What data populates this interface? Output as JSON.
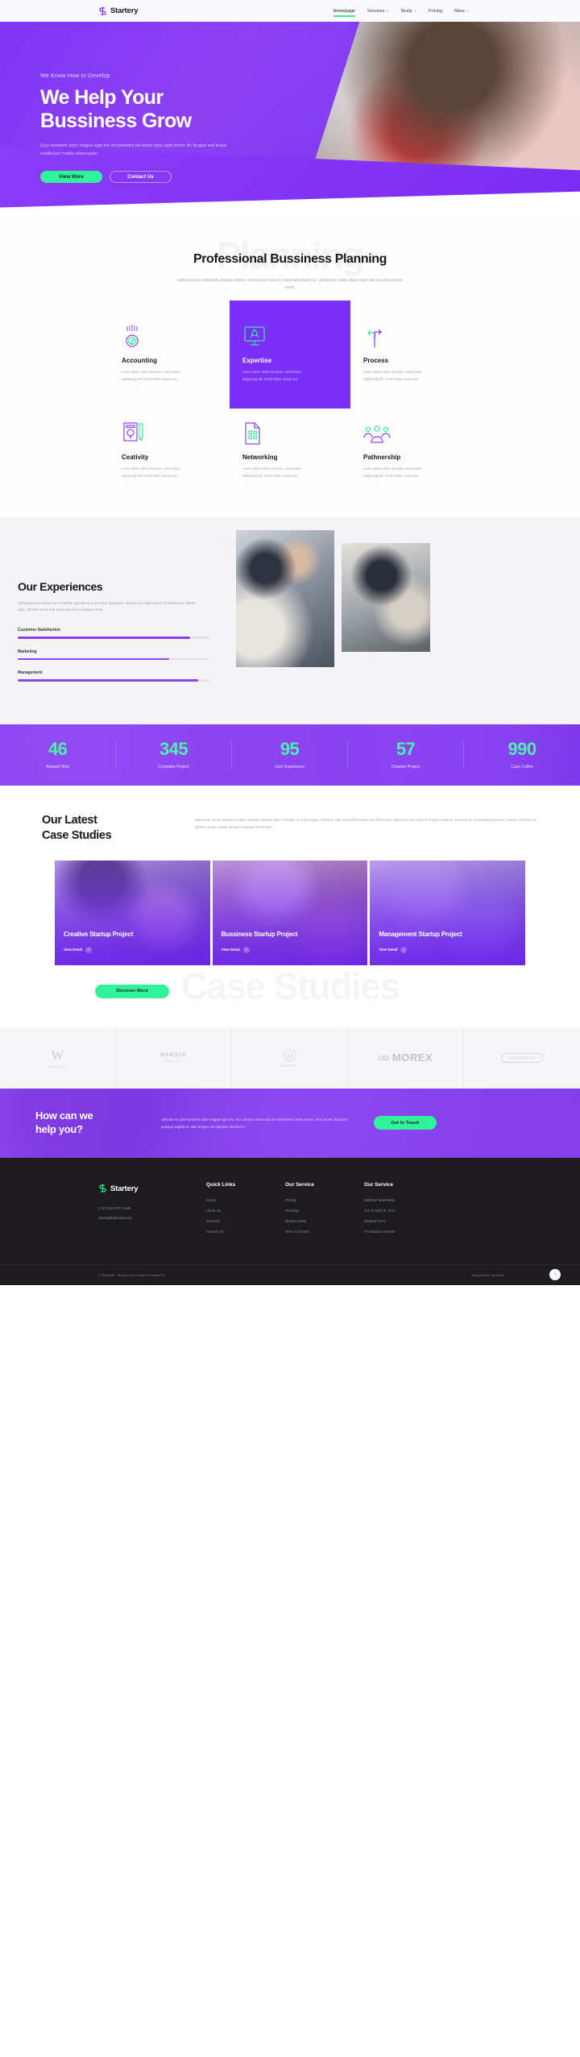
{
  "brand": {
    "name": "Startery",
    "logo_icon": "s-logo-icon",
    "accent": "#7b2ff7",
    "green": "#2ff29b"
  },
  "nav": {
    "items": [
      {
        "label": "Homepage",
        "active": true,
        "caret": ""
      },
      {
        "label": "Services",
        "active": false,
        "caret": "˅"
      },
      {
        "label": "Study",
        "active": false,
        "caret": "˅"
      },
      {
        "label": "Pricing",
        "active": false,
        "caret": ""
      },
      {
        "label": "More",
        "active": false,
        "caret": "˅"
      }
    ]
  },
  "hero": {
    "eyebrow": "We Know How to Develop",
    "title_line1": "We Help Your",
    "title_line2": "Bussiness Grow",
    "desc": "Quis hendrerit dolor magna eget est vel pharetra vel turpis nunc eget lorem. Ac feugiat sed lectus vestibulum mattis ullamcorper.",
    "btn_primary": "View More",
    "btn_secondary": "Contact Us"
  },
  "planning": {
    "ghost": "Planning",
    "title": "Professional Bussiness Planning",
    "sub": "Nulla posuere sollicitudin aliquam ultrices. Senectus et netus et malesuada fames ac. Vestibulum mattis ullamcorper velit sed ullamcorper morbi.",
    "cards": [
      {
        "icon": "coin-dollar-icon",
        "title": "Accounting",
        "text": "Lorem ipsum dolor sit amet, consectetur adipiscing elit. Ut elit tellus, luctus nec.",
        "featured": false
      },
      {
        "icon": "rocket-monitor-icon",
        "title": "Expertise",
        "text": "Lorem ipsum dolor sit amet, consectetur adipiscing elit. Ut elit tellus, luctus nec.",
        "featured": true
      },
      {
        "icon": "arrows-split-icon",
        "title": "Process",
        "text": "Lorem ipsum dolor sit amet, consectetur adipiscing elit. Ut elit tellus, luctus nec.",
        "featured": false
      },
      {
        "icon": "lightbulb-pencil-icon",
        "title": "Ceativity",
        "text": "Lorem ipsum dolor sit amet, consectetur adipiscing elit. Ut elit tellus, luctus nec.",
        "featured": false
      },
      {
        "icon": "document-grid-icon",
        "title": "Networking",
        "text": "Lorem ipsum dolor sit amet, consectetur adipiscing elit. Ut elit tellus, luctus nec.",
        "featured": false
      },
      {
        "icon": "people-group-icon",
        "title": "Pathnership",
        "text": "Lorem ipsum dolor sit amet, consectetur adipiscing elit. Ut elit tellus, luctus nec.",
        "featured": false
      }
    ]
  },
  "experiences": {
    "ghost": "Services",
    "title": "Our Experiences",
    "desc": "Volutpat lacus laoreet non curabitur gravida arcu ac tortor dignissim. Aliquet nec ullamcorper sit amet risus nullam eget. Ultricies lacus sed turpis tincidunt id aliquet risus.",
    "bars": [
      {
        "label": "Customer Satisfaction",
        "value": 90
      },
      {
        "label": "Marketing",
        "value": 79
      },
      {
        "label": "Management",
        "value": 94
      }
    ]
  },
  "stats": [
    {
      "value": "46",
      "label": "Awward Won"
    },
    {
      "value": "345",
      "label": "Complete Project"
    },
    {
      "value": "95",
      "label": "User Experience"
    },
    {
      "value": "57",
      "label": "Creative Project"
    },
    {
      "value": "990",
      "label": "Cups Coffee"
    }
  ],
  "cases": {
    "ghost": "Case Studies",
    "title_line1": "Our Latest",
    "title_line2": "Case Studies",
    "desc": "Bibendum neque egestas congue quisque egestas diam. Fringilla ut morbi augue interdum velit. Est pellentesque elit ullamcorper dignissim cras lobortis feugiat vivamus. Posuere ac ut consequat semper viverra. Pharetra et ultrices neque ornare aenean euismod elementum.",
    "items": [
      {
        "name": "Creative Startup Project",
        "link": "View Detail",
        "arrow": "›"
      },
      {
        "name": "Bussiness Startup Project",
        "link": "View Detail",
        "arrow": "›"
      },
      {
        "name": "Management Startup Project",
        "link": "View Detail",
        "arrow": "›"
      }
    ],
    "discover": "Discover More"
  },
  "logos": [
    {
      "kind": "serif",
      "mark": "W",
      "caption": "WISCONSIN"
    },
    {
      "kind": "text",
      "mark": "MARQUE",
      "caption": "POULCOUST"
    },
    {
      "kind": "circle",
      "mark": "",
      "caption": "CAROUSEL"
    },
    {
      "kind": "big",
      "mark": "MOREX",
      "caption": ""
    },
    {
      "kind": "pill",
      "mark": "CIRCUMSTANCE",
      "caption": ""
    }
  ],
  "cta": {
    "title_line1": "How can we",
    "title_line2": "help you?",
    "desc": "Ultricies mi quis hendrerit dolor magna eget est. Arcu dictum varius duis at consectetur lorem donec. Eros donec dictumst quisque sagittis ac odio tempor orci dapibus ultricies in.",
    "button": "Get In Touch"
  },
  "footer": {
    "brand": "Startery",
    "phone": "(+67) 222 879 4468",
    "email": "startupkit@mail.com",
    "columns": [
      {
        "heading": "Quick Links",
        "links": [
          "Home",
          "About Us",
          "Services",
          "Contact Us"
        ]
      },
      {
        "heading": "Our Service",
        "links": [
          "Pricing",
          "Tracking",
          "Report a Bug",
          "Term of Service"
        ]
      },
      {
        "heading": "Our Service",
        "links": [
          "Midtown Manhattan",
          "112 W 34th St, NYC",
          "Madison NYC",
          "57 Madison Avenue"
        ]
      }
    ],
    "copyright": "© Startupkit - Startup and Creative Template Kit",
    "credit": "Designed by Tokopress",
    "totop_icon": "arrow-up-icon",
    "totop_glyph": "↑"
  }
}
